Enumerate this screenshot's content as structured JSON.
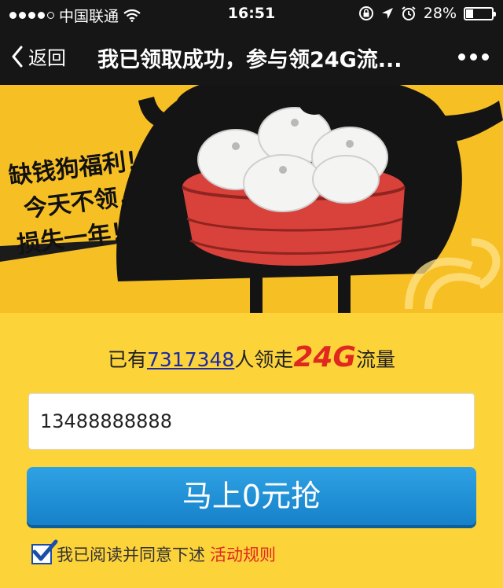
{
  "status": {
    "carrier": "中国联通",
    "time": "16:51",
    "battery": "28%",
    "battery_level": 0.28
  },
  "nav": {
    "back_label": "返回",
    "title": "我已领取成功，参与领24G流..."
  },
  "banner": {
    "slogan": [
      "缺钱狗福利！",
      "今天不领，",
      "损失一年！"
    ],
    "colors": {
      "background": "#f6bf24",
      "steamer": "#d9413b",
      "character": "#111111"
    }
  },
  "claim": {
    "prefix": "已有",
    "count": "7317348",
    "middle": "人领走",
    "amount": "24G",
    "suffix": "流量"
  },
  "phone_input": {
    "value": "13488888888"
  },
  "cta": {
    "label": "马上0元抢"
  },
  "agreement": {
    "checked": true,
    "text": "我已阅读并同意下述",
    "link": "活动规则"
  },
  "colors": {
    "page_bg": "#fdd33a",
    "button": "#1a8bd6",
    "accent_red": "#e0281f",
    "link_blue": "#1a2aa8"
  }
}
